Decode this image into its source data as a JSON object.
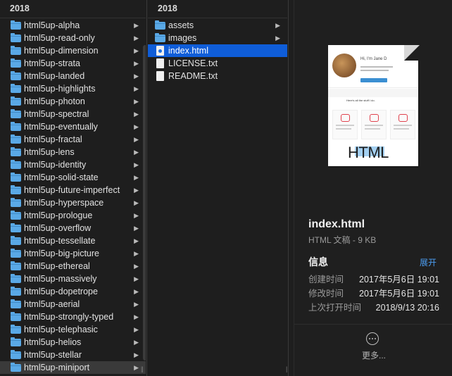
{
  "column1": {
    "header": "2018",
    "items": [
      {
        "label": "html5up-alpha"
      },
      {
        "label": "html5up-read-only"
      },
      {
        "label": "html5up-dimension"
      },
      {
        "label": "html5up-strata"
      },
      {
        "label": "html5up-landed"
      },
      {
        "label": "html5up-highlights"
      },
      {
        "label": "html5up-photon"
      },
      {
        "label": "html5up-spectral"
      },
      {
        "label": "html5up-eventually"
      },
      {
        "label": "html5up-fractal"
      },
      {
        "label": "html5up-lens"
      },
      {
        "label": "html5up-identity"
      },
      {
        "label": "html5up-solid-state"
      },
      {
        "label": "html5up-future-imperfect"
      },
      {
        "label": "html5up-hyperspace"
      },
      {
        "label": "html5up-prologue"
      },
      {
        "label": "html5up-overflow"
      },
      {
        "label": "html5up-tessellate"
      },
      {
        "label": "html5up-big-picture"
      },
      {
        "label": "html5up-ethereal"
      },
      {
        "label": "html5up-massively"
      },
      {
        "label": "html5up-dopetrope"
      },
      {
        "label": "html5up-aerial"
      },
      {
        "label": "html5up-strongly-typed"
      },
      {
        "label": "html5up-telephasic"
      },
      {
        "label": "html5up-helios"
      },
      {
        "label": "html5up-stellar"
      },
      {
        "label": "html5up-miniport",
        "selected": true
      }
    ]
  },
  "column2": {
    "header": "2018",
    "items": [
      {
        "label": "assets",
        "kind": "folder"
      },
      {
        "label": "images",
        "kind": "folder"
      },
      {
        "label": "index.html",
        "kind": "html",
        "active": true
      },
      {
        "label": "LICENSE.txt",
        "kind": "file"
      },
      {
        "label": "README.txt",
        "kind": "file"
      }
    ]
  },
  "preview": {
    "thumbnail_text": "HTML",
    "thumbnail_greeting": "Hi, I'm Jane D",
    "thumbnail_section": "Here's all the stuff I do.",
    "file_name": "index.html",
    "file_kind": "HTML 文稿 - 9 KB",
    "info_title": "信息",
    "expand_label": "展开",
    "rows": [
      {
        "key": "创建时间",
        "value": "2017年5月6日 19:01"
      },
      {
        "key": "修改时间",
        "value": "2017年5月6日 19:01"
      },
      {
        "key": "上次打开时间",
        "value": "2018/9/13 20:16"
      }
    ],
    "more_label": "更多..."
  },
  "colors": {
    "background": "#1e1e1e",
    "selection_active": "#0f5dd8",
    "selection_inactive": "#3a3a3a",
    "folder": "#5aa9e6",
    "link": "#4b9cf0"
  },
  "icons": {
    "folder": "folder-icon",
    "file": "document-icon",
    "html_file": "html-file-icon",
    "disclosure": "chevron-right-icon",
    "more": "ellipsis-circle-icon"
  }
}
